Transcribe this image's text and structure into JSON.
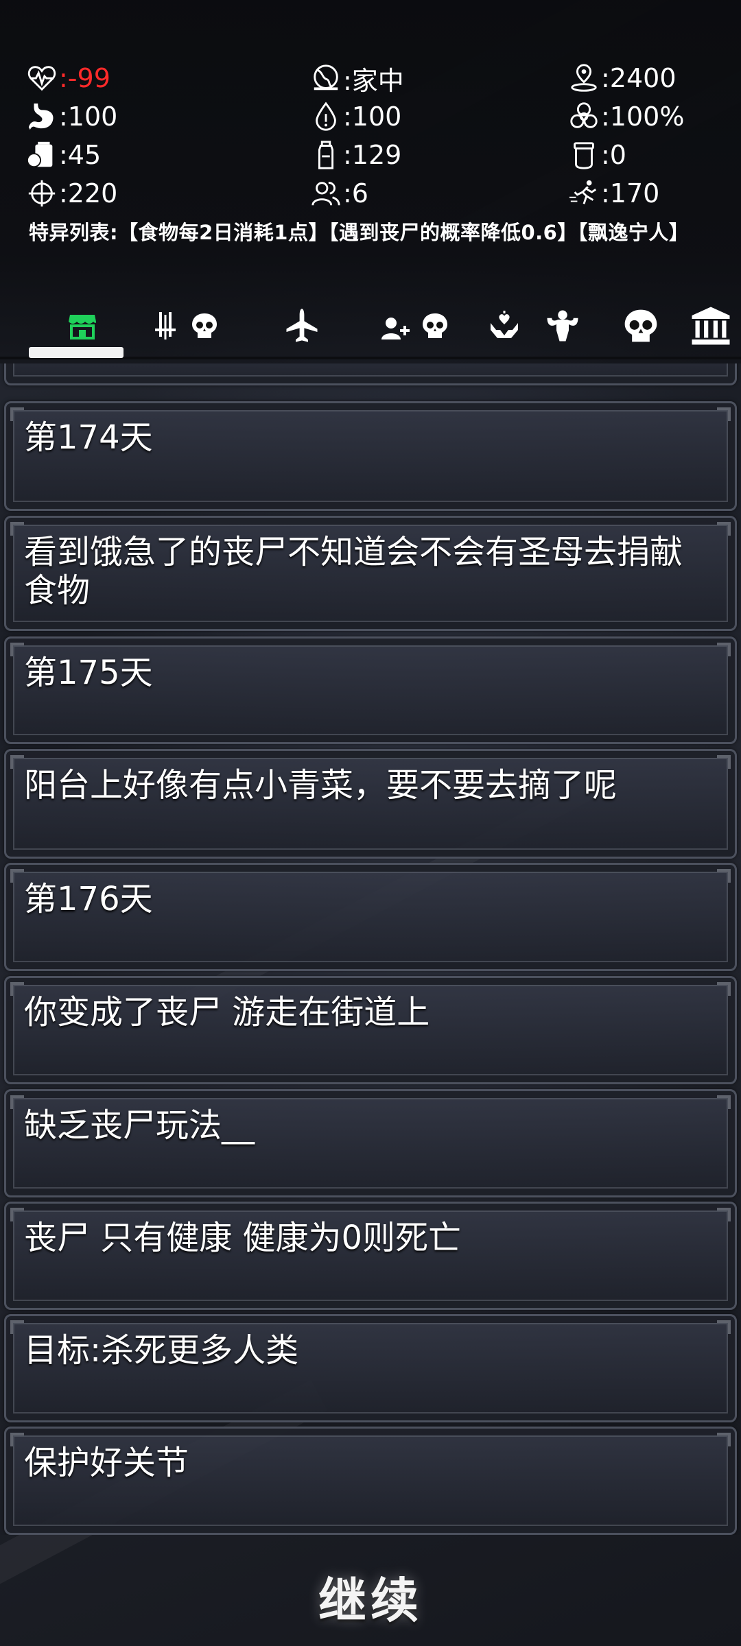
{
  "stats": {
    "health": ":-99",
    "location": ":家中",
    "distance": ":2400",
    "hunger": ":100",
    "thirst": ":100",
    "infection": ":100%",
    "food": ":45",
    "water": ":129",
    "supplies": ":0",
    "attack": ":220",
    "survivors": ":6",
    "speed": ":170"
  },
  "traits": "特异列表:【食物每2日消耗1点】【遇到丧尸的概率降低0.6】【飘逸宁人】",
  "tabs": [
    {
      "icon": "shop-icon",
      "active": true
    },
    {
      "icon": "weapons-skull-icon"
    },
    {
      "icon": "airplane-icon"
    },
    {
      "icon": "add-person-skull-icon"
    },
    {
      "icon": "heal-icon"
    },
    {
      "icon": "strength-icon"
    },
    {
      "icon": "skull-icon"
    },
    {
      "icon": "bank-icon"
    }
  ],
  "log": [
    {
      "text": "第174天"
    },
    {
      "text": "看到饿急了的丧尸不知道会不会有圣母去捐献食物"
    },
    {
      "text": "第175天"
    },
    {
      "text": "阳台上好像有点小青菜，要不要去摘了呢"
    },
    {
      "text": "第176天"
    },
    {
      "text": "你变成了丧尸 游走在街道上"
    },
    {
      "text": "缺乏丧尸玩法__"
    },
    {
      "text": "丧尸 只有健康 健康为0则死亡"
    },
    {
      "text": "目标:杀死更多人类"
    },
    {
      "text": "保护好关节"
    }
  ],
  "continue_label": "继续",
  "colors": {
    "health_value": "#ff2a2a",
    "active_tab": "#1fd15a"
  }
}
